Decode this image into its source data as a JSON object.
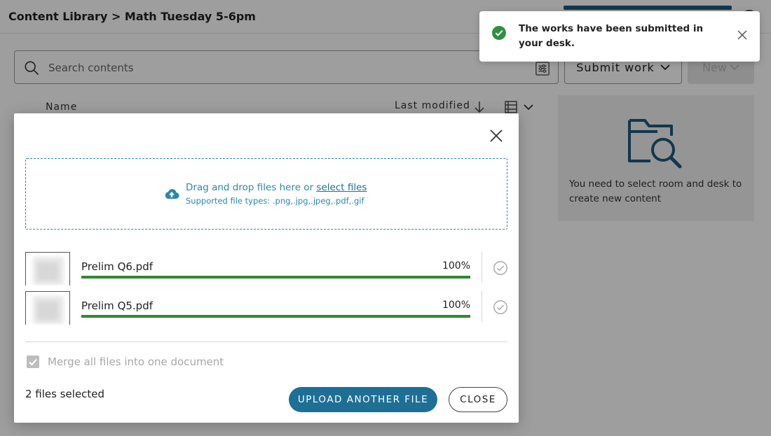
{
  "header": {
    "breadcrumb": "Content Library > Math Tuesday 5-6pm"
  },
  "search": {
    "placeholder": "Search contents"
  },
  "toolbar": {
    "submit_label": "Submit work",
    "new_label": "New"
  },
  "list": {
    "col_name": "Name",
    "col_last_modified": "Last modified"
  },
  "side_panel": {
    "message": "You need to select room and desk to create new content"
  },
  "dialog": {
    "dropzone": {
      "text": "Drag and drop files here or",
      "link": "select files",
      "supported": "Supported file types: .png,.jpg,.jpeg,.pdf,.gif"
    },
    "files": [
      {
        "name": "Prelim Q6.pdf",
        "percent": "100%",
        "progress": 1.0
      },
      {
        "name": "Prelim Q5.pdf",
        "percent": "100%",
        "progress": 1.0
      }
    ],
    "merge_label": "Merge all files into one document",
    "merge_checked": true,
    "selected_count": "2 files selected",
    "upload_label": "UPLOAD ANOTHER FILE",
    "close_label": "CLOSE"
  },
  "toast": {
    "message": "The works have been submitted in your desk."
  },
  "colors": {
    "accent": "#1e6f96",
    "link": "#2a88a8",
    "success": "#2f8a2f",
    "toast_icon": "#2e9140"
  }
}
